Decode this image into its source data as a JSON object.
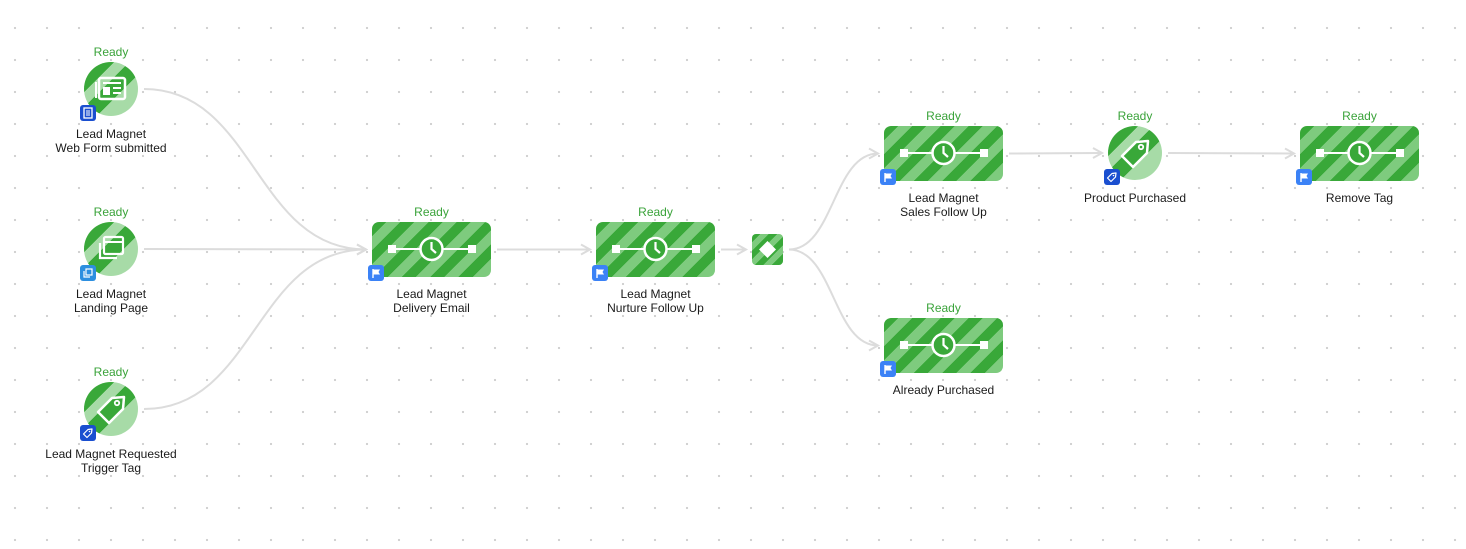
{
  "colors": {
    "status": "#3aa33a",
    "stripe_dark": "#39a839",
    "stripe_light": "#7ecb7e",
    "edge": "#dcdcdc",
    "badge_flag": "#3b82f6",
    "badge_form": "#1a4fd0",
    "badge_page": "#2d8fe0",
    "badge_tag": "#1a4fd0"
  },
  "nodes": [
    {
      "id": "web-form",
      "type": "trigger",
      "icon": "web-form-icon",
      "badge": "form-badge-icon",
      "status": "Ready",
      "label_line1": "Lead Magnet",
      "label_line2": "Web Form submitted"
    },
    {
      "id": "landing-page",
      "type": "trigger",
      "icon": "landing-page-icon",
      "badge": "page-badge-icon",
      "status": "Ready",
      "label_line1": "Lead Magnet",
      "label_line2": "Landing Page"
    },
    {
      "id": "trigger-tag",
      "type": "trigger",
      "icon": "tag-icon",
      "badge": "tag-badge-icon",
      "status": "Ready",
      "label_line1": "Lead Magnet Requested",
      "label_line2": "Trigger Tag"
    },
    {
      "id": "delivery-email",
      "type": "sequence",
      "icon": "timer-icon",
      "badge": "flag-badge-icon",
      "status": "Ready",
      "label_line1": "Lead Magnet",
      "label_line2": "Delivery Email"
    },
    {
      "id": "nurture-follow-up",
      "type": "sequence",
      "icon": "timer-icon",
      "badge": "flag-badge-icon",
      "status": "Ready",
      "label_line1": "Lead Magnet",
      "label_line2": "Nurture Follow Up"
    },
    {
      "id": "decision",
      "type": "decision",
      "icon": "diamond-icon"
    },
    {
      "id": "sales-follow-up",
      "type": "sequence",
      "icon": "timer-icon",
      "badge": "flag-badge-icon",
      "status": "Ready",
      "label_line1": "Lead Magnet",
      "label_line2": "Sales Follow Up"
    },
    {
      "id": "product-purchased",
      "type": "goal",
      "icon": "tag-icon",
      "badge": "tag-badge-icon",
      "status": "Ready",
      "label_line1": "Product Purchased",
      "label_line2": ""
    },
    {
      "id": "remove-tag",
      "type": "sequence",
      "icon": "timer-icon",
      "badge": "flag-badge-icon",
      "status": "Ready",
      "label_line1": "Remove Tag",
      "label_line2": ""
    },
    {
      "id": "already-purchased",
      "type": "sequence",
      "icon": "timer-icon",
      "badge": "flag-badge-icon",
      "status": "Ready",
      "label_line1": "Already Purchased",
      "label_line2": ""
    }
  ],
  "edges": [
    {
      "from": "web-form",
      "to": "delivery-email"
    },
    {
      "from": "landing-page",
      "to": "delivery-email"
    },
    {
      "from": "trigger-tag",
      "to": "delivery-email"
    },
    {
      "from": "delivery-email",
      "to": "nurture-follow-up"
    },
    {
      "from": "nurture-follow-up",
      "to": "decision"
    },
    {
      "from": "decision",
      "to": "sales-follow-up"
    },
    {
      "from": "decision",
      "to": "already-purchased"
    },
    {
      "from": "sales-follow-up",
      "to": "product-purchased"
    },
    {
      "from": "product-purchased",
      "to": "remove-tag"
    }
  ]
}
